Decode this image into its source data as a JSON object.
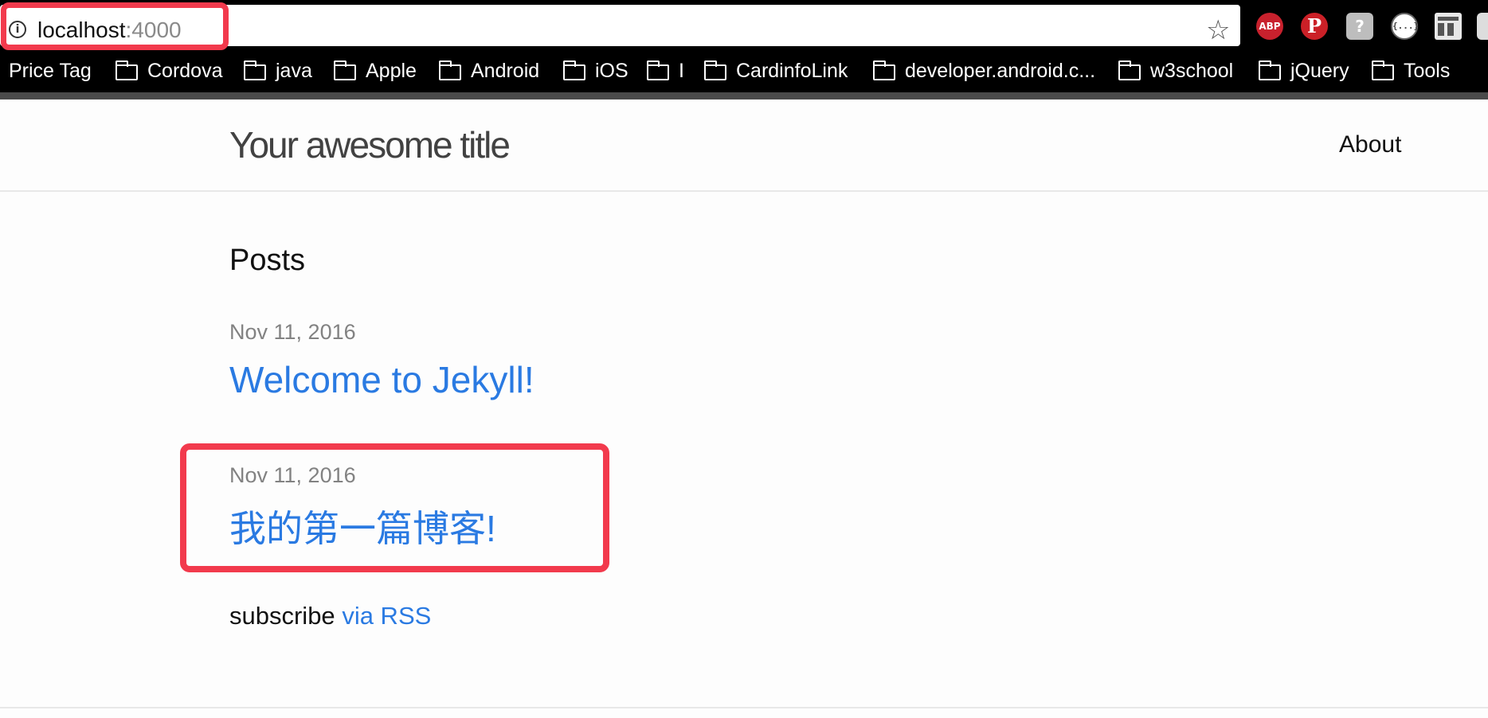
{
  "browser": {
    "url_host": "localhost",
    "url_port": ":4000",
    "icons": {
      "info": "info-icon",
      "star": "star-icon"
    },
    "extensions": [
      {
        "name": "adblock-plus",
        "label": "ABP",
        "color": "#c8212d"
      },
      {
        "name": "pinterest",
        "label": "P",
        "color": "#cb2027"
      },
      {
        "name": "tag",
        "label": "?",
        "color": "#bdbdbd"
      },
      {
        "name": "json-viewer",
        "label": "{...}",
        "color": "#ffffff"
      },
      {
        "name": "layout",
        "label": "",
        "color": "#555555"
      }
    ],
    "bookmarks": [
      "Price Tag",
      "Cordova",
      "java",
      "Apple",
      "Android",
      "iOS",
      "I",
      "CardinfoLink",
      "developer.android.c...",
      "w3school",
      "jQuery",
      "Tools"
    ]
  },
  "site": {
    "title": "Your awesome title",
    "nav": {
      "about": "About"
    }
  },
  "main": {
    "heading": "Posts",
    "posts": [
      {
        "date": "Nov 11, 2016",
        "title": "Welcome to Jekyll!"
      },
      {
        "date": "Nov 11, 2016",
        "title": "我的第一篇博客!"
      }
    ],
    "subscribe_text": "subscribe",
    "subscribe_link": "via RSS"
  },
  "colors": {
    "highlight": "#f23a4d",
    "link": "#2a7ae2",
    "meta": "#828282"
  }
}
